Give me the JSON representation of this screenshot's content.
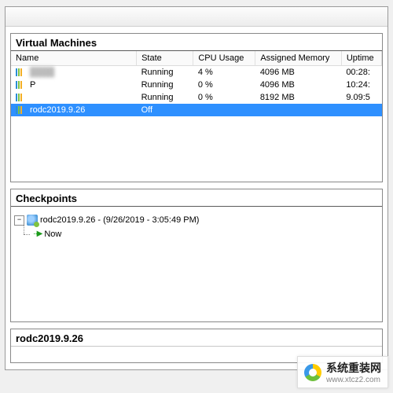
{
  "panels": {
    "vm_title": "Virtual Machines",
    "cp_title": "Checkpoints",
    "detail_title": "rodc2019.9.26"
  },
  "vm_table": {
    "headers": {
      "name": "Name",
      "state": "State",
      "cpu": "CPU Usage",
      "mem": "Assigned Memory",
      "uptime": "Uptime"
    },
    "rows": [
      {
        "name": "",
        "state": "Running",
        "cpu": "4 %",
        "mem": "4096 MB",
        "uptime": "00:28:",
        "selected": false,
        "blurred": true
      },
      {
        "name": "P",
        "state": "Running",
        "cpu": "0 %",
        "mem": "4096 MB",
        "uptime": "10:24:",
        "selected": false,
        "blurred": false
      },
      {
        "name": "",
        "state": "Running",
        "cpu": "0 %",
        "mem": "8192 MB",
        "uptime": "9.09:5",
        "selected": false,
        "blurred": false
      },
      {
        "name": "rodc2019.9.26",
        "state": "Off",
        "cpu": "",
        "mem": "",
        "uptime": "",
        "selected": true,
        "blurred": false
      }
    ]
  },
  "checkpoints": {
    "node_label": "rodc2019.9.26 - (9/26/2019 - 3:05:49 PM)",
    "now_label": "Now",
    "expander_glyph": "−"
  },
  "watermark": {
    "line1": "系统重装网",
    "line2": "www.xtcz2.com"
  }
}
